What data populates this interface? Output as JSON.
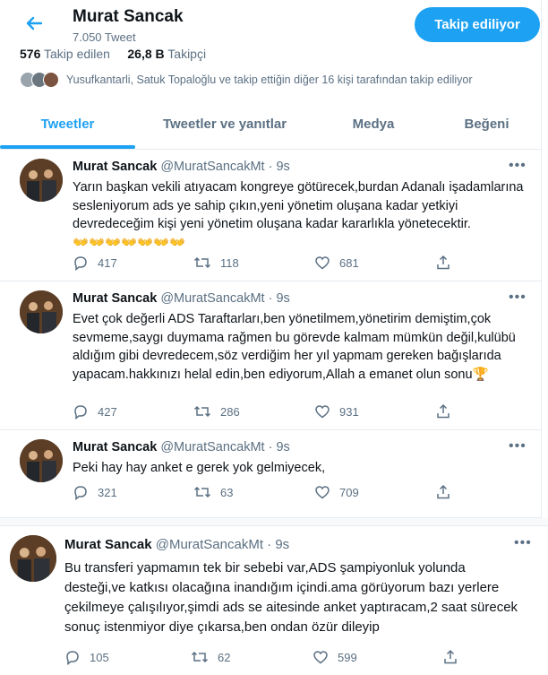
{
  "header": {
    "name": "Murat Sancak",
    "tweet_count": "7.050 Tweet",
    "follow_button": "Takip ediliyor"
  },
  "stats": {
    "following_value": "576",
    "following_label": "Takip edilen",
    "followers_value": "26,8 B",
    "followers_label": "Takipçi"
  },
  "followers_you_know": "Yusufkantarli, Satuk Topaloğlu ve takip ettiğin diğer 16 kişi tarafından takip ediliyor",
  "tabs": [
    "Tweetler",
    "Tweetler ve yanıtlar",
    "Medya",
    "Beğeni"
  ],
  "tweets": [
    {
      "name": "Murat Sancak",
      "handle": "@MuratSancakMt",
      "time": "· 9s",
      "text": "Yarın başkan vekili atıyacam kongreye götürecek,burdan Adanalı işadamlarına sesleniyorum ads ye sahip çıkın,yeni yönetim oluşana kadar yetkiyi devredeceğim kişi yeni yönetim oluşana kadar kararlıkla yönetecektir.",
      "emojis": "👐👐👐👐👐👐👐",
      "replies": "417",
      "retweets": "118",
      "likes": "681"
    },
    {
      "name": "Murat Sancak",
      "handle": "@MuratSancakMt",
      "time": "· 9s",
      "text": "Evet çok değerli ADS Taraftarları,ben yönetilmem,yönetirim demiştim,çok sevmeme,saygı duymama rağmen bu görevde kalmam mümkün değil,kulübü aldığım gibi devredecem,söz verdiğim her yıl yapmam gereken bağışlarıda yapacam.hakkınızı helal edin,ben ediyorum,Allah a emanet olun sonu🏆",
      "replies": "427",
      "retweets": "286",
      "likes": "931"
    },
    {
      "name": "Murat Sancak",
      "handle": "@MuratSancakMt",
      "time": "· 9s",
      "text": "Peki hay hay anket e gerek yok gelmiyecek,",
      "replies": "321",
      "retweets": "63",
      "likes": "709"
    },
    {
      "name": "Murat Sancak",
      "handle": "@MuratSancakMt",
      "time": "· 9s",
      "text": "Bu transferi yapmamın tek bir sebebi var,ADS şampiyonluk yolunda desteği,ve katkısı olacağına inandığım içindi.ama görüyorum bazı yerlere çekilmeye çalışılıyor,şimdi ads se aitesinde anket yaptıracam,2 saat sürecek sonuç istenmiyor diye çıkarsa,ben ondan özür dileyip",
      "replies": "105",
      "retweets": "62",
      "likes": "599"
    }
  ],
  "colors": {
    "accent": "#1da1f2",
    "muted": "#5b7083",
    "text": "#0f1419"
  },
  "icons": [
    "back-arrow-icon",
    "more-icon",
    "reply-icon",
    "retweet-icon",
    "like-icon",
    "share-icon"
  ]
}
